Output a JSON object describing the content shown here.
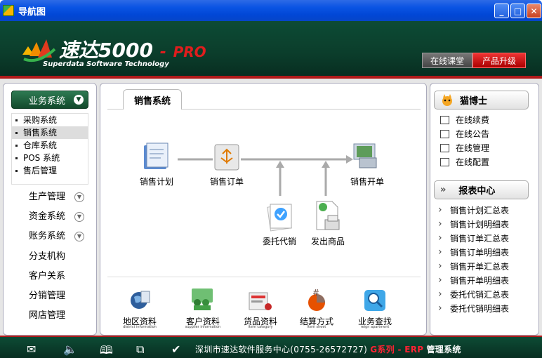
{
  "window": {
    "title": "导航图"
  },
  "header": {
    "brand_cn": "速达",
    "brand_num": "5000",
    "brand_dash": "-",
    "brand_pro": "PRO",
    "tagline": "Superdata Software Technology",
    "online_class": "在线课堂",
    "upgrade": "产品升级"
  },
  "leftnav": {
    "active": "业务系统",
    "sub": [
      "采购系统",
      "销售系统",
      "仓库系统",
      "POS 系统",
      "售后管理"
    ],
    "selected_sub": "销售系统",
    "items": [
      {
        "label": "生产管理",
        "expandable": true
      },
      {
        "label": "资金系统",
        "expandable": true
      },
      {
        "label": "账务系统",
        "expandable": true
      },
      {
        "label": "分支机构",
        "expandable": false
      },
      {
        "label": "客户关系",
        "expandable": false
      },
      {
        "label": "分销管理",
        "expandable": false
      },
      {
        "label": "网店管理",
        "expandable": false
      }
    ]
  },
  "center": {
    "tab": "销售系统",
    "flow": {
      "plan": "销售计划",
      "order": "销售订单",
      "invoice": "销售开单",
      "consign": "委托代销",
      "ship": "发出商品"
    },
    "bottom": [
      {
        "label": "地区资料",
        "sub": "district information"
      },
      {
        "label": "客户资料",
        "sub": "supplier information"
      },
      {
        "label": "货品资料",
        "sub": "item category"
      },
      {
        "label": "结算方式",
        "sub": "item sheet"
      },
      {
        "label": "业务查找",
        "sub": "reign apartment"
      }
    ]
  },
  "right": {
    "cat_title": "猫博士",
    "cat_links": [
      "在线续费",
      "在线公告",
      "在线管理",
      "在线配置"
    ],
    "report_title": "报表中心",
    "reports": [
      "销售计划汇总表",
      "销售计划明细表",
      "销售订单汇总表",
      "销售订单明细表",
      "销售开单汇总表",
      "销售开单明细表",
      "委托代销汇总表",
      "委托代销明细表"
    ]
  },
  "footer": {
    "text": "深圳市速达软件服务中心(0755-26572727)",
    "g_series": "G系列 - ERP",
    "mgmt": "管理系统"
  }
}
